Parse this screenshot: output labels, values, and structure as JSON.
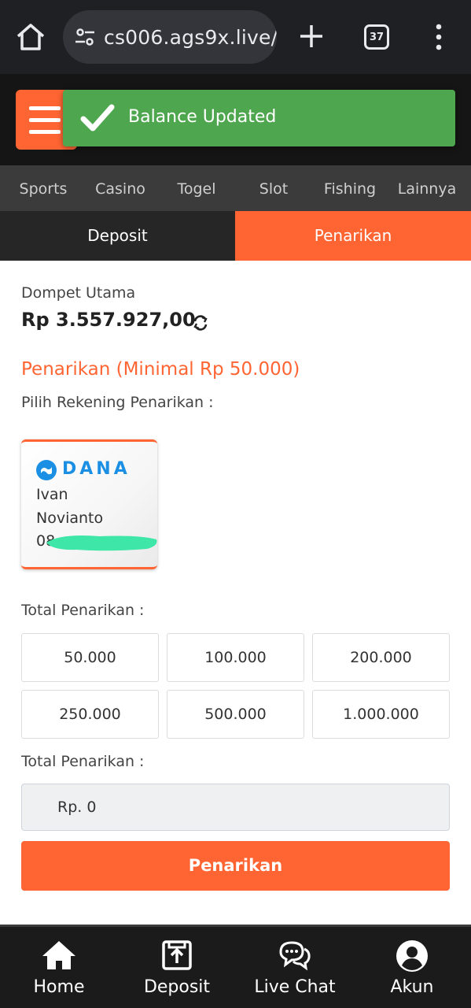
{
  "browser": {
    "url": "cs006.ags9x.live/",
    "tab_count": "37"
  },
  "header": {
    "toast_text": "Balance Updated"
  },
  "categories": [
    "Sports",
    "Casino",
    "Togel",
    "Slot",
    "Fishing",
    "Lainnya"
  ],
  "tabs": {
    "deposit": "Deposit",
    "withdraw": "Penarikan"
  },
  "wallet": {
    "label": "Dompet Utama",
    "balance": "Rp 3.557.927,00"
  },
  "withdraw": {
    "title": "Penarikan (Minimal Rp 50.000)",
    "choose_account_label": "Pilih Rekening Penarikan :",
    "account": {
      "bank": "DANA",
      "name_line1": "Ivan",
      "name_line2": "Novianto",
      "number_partial": "08"
    },
    "total_label": "Total Penarikan :",
    "amounts": [
      "50.000",
      "100.000",
      "200.000",
      "250.000",
      "500.000",
      "1.000.000"
    ],
    "total_label_2": "Total Penarikan :",
    "input_value": "Rp. 0",
    "submit_label": "Penarikan"
  },
  "bottom_nav": {
    "home": "Home",
    "deposit": "Deposit",
    "live_chat": "Live Chat",
    "account": "Akun"
  },
  "colors": {
    "accent": "#ff6533",
    "toast": "#4ea64e",
    "dana_blue": "#1a8fe3"
  }
}
